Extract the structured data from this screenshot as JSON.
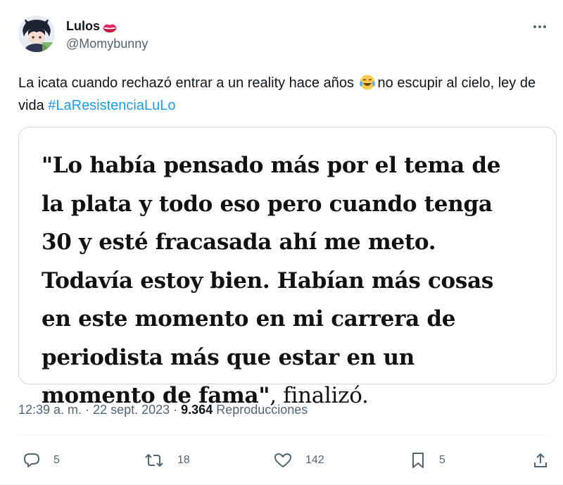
{
  "author": {
    "display_name": "Lulos",
    "display_name_emoji": "lips-icon",
    "handle": "@Momybunny"
  },
  "tweet": {
    "text_before_emoji": "La icata cuando rechazó entrar a un reality hace años ",
    "emoji": "face-with-tears-of-joy-icon",
    "text_after_emoji": "no escupir al cielo, ley de vida ",
    "hashtag": "#LaResistenciaLuLo"
  },
  "quote_image": {
    "bold_text": "\"Lo había pensado más por el tema de la plata y todo eso pero cuando tenga 30 y esté fracasada ahí me meto. Todavía estoy bien. Habían más cosas en este momento en mi carrera de periodista más que estar en un momento de fama\"",
    "tail_text": ", finalizó."
  },
  "meta": {
    "time": "12:39 a. m.",
    "separator": " · ",
    "date": "22 sept. 2023",
    "views_count": "9.364",
    "views_label": " Reproducciones"
  },
  "actions": {
    "replies": "5",
    "retweets": "18",
    "likes": "142",
    "bookmarks": "5"
  },
  "colors": {
    "text_primary": "#0f1419",
    "text_secondary": "#536471",
    "link": "#1d9bf0",
    "border": "#cfd9de"
  }
}
